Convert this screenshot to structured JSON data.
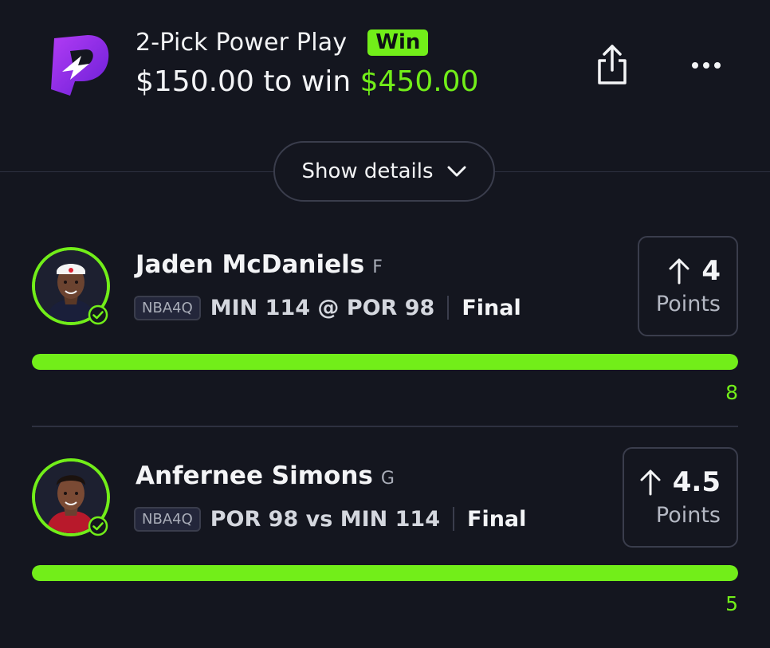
{
  "header": {
    "logo_icon": "prizepicks-logo-icon",
    "play_type": "2-Pick Power Play",
    "result_badge": "Win",
    "amount_prefix": "$150.00 to win",
    "amount_win": "$450.00",
    "share_icon": "share-icon",
    "more_icon": "more-options-icon"
  },
  "details_button": {
    "label": "Show details",
    "icon": "chevron-down-icon"
  },
  "picks": [
    {
      "player_name": "Jaden McDaniels",
      "position": "F",
      "league": "NBA4Q",
      "matchup": "MIN 114 @ POR 98",
      "status": "Final",
      "direction_icon": "arrow-up-icon",
      "line_value": "4",
      "line_unit": "Points",
      "actual_value": "8",
      "progress_fraction": 1.0,
      "avatar_icon": "player-avatar-icon",
      "check_icon": "check-circle-icon"
    },
    {
      "player_name": "Anfernee Simons",
      "position": "G",
      "league": "NBA4Q",
      "matchup": "POR 98 vs MIN 114",
      "status": "Final",
      "direction_icon": "arrow-up-icon",
      "line_value": "4.5",
      "line_unit": "Points",
      "actual_value": "5",
      "progress_fraction": 1.0,
      "avatar_icon": "player-avatar-icon",
      "check_icon": "check-circle-icon"
    }
  ],
  "colors": {
    "background": "#14161f",
    "accent": "#72ee19",
    "brand_purple": "#8a2be2",
    "border": "#3a3d4c"
  }
}
